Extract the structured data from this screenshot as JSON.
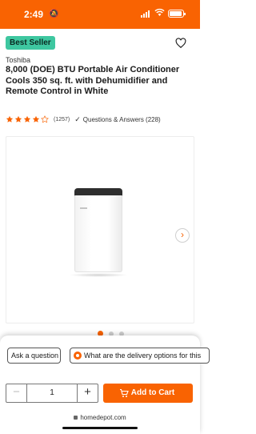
{
  "status_bar": {
    "time": "2:49",
    "bell_icon": "bell-slash-icon",
    "color": "#f96302"
  },
  "product": {
    "badge": "Best Seller",
    "brand": "Toshiba",
    "title": "8,000 (DOE) BTU Portable Air Conditioner Cools 350 sq. ft. with Dehumidifier and Remote Control in White",
    "rating": 4,
    "rating_max": 5,
    "review_count": "(1257)",
    "qa_link": "Questions & Answers (228)"
  },
  "gallery": {
    "image_count": 3,
    "active_index": 0
  },
  "bottom_sheet": {
    "ask_question": "Ask a question",
    "delivery_question": "What are the delivery options for this",
    "quantity": "1",
    "minus": "−",
    "plus": "+",
    "add_to_cart": "Add to Cart",
    "url": "homedepot.com"
  },
  "colors": {
    "brand_orange": "#f96302",
    "badge_green": "#3ec7a0"
  }
}
